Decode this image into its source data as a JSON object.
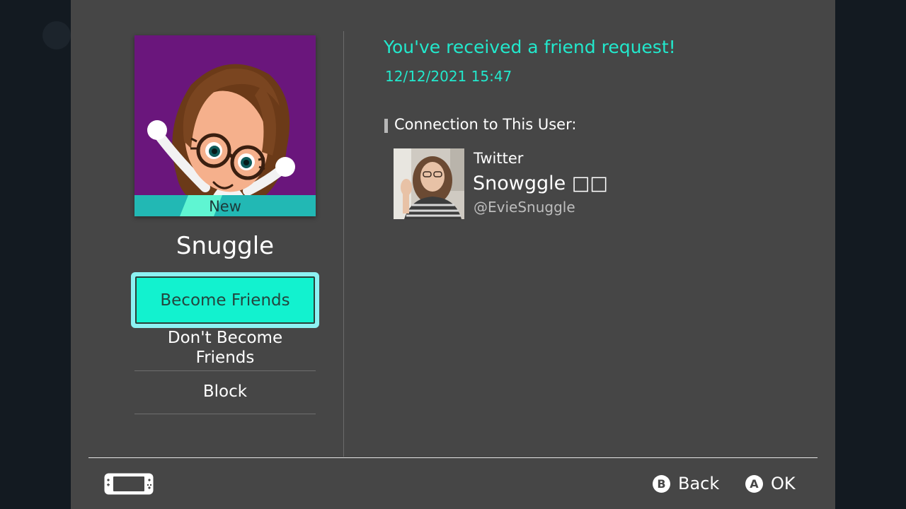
{
  "profile": {
    "badge": "New",
    "name": "Snuggle"
  },
  "actions": {
    "become_friends": "Become Friends",
    "dont_become_friends_line1": "Don't Become",
    "dont_become_friends_line2": "Friends",
    "block": "Block"
  },
  "request": {
    "title": "You've received a friend request!",
    "datetime": "12/12/2021 15:47"
  },
  "connection": {
    "heading": "Connection to This User:",
    "service": "Twitter",
    "display_name": "Snowggle □□",
    "handle": "@EvieSnuggle"
  },
  "footer": {
    "back_key": "B",
    "back_label": "Back",
    "ok_key": "A",
    "ok_label": "OK"
  },
  "colors": {
    "accent": "#12f2cf",
    "highlight_border": "#8cf2f2",
    "panel": "#464646",
    "avatar_bg": "#6a167c"
  }
}
